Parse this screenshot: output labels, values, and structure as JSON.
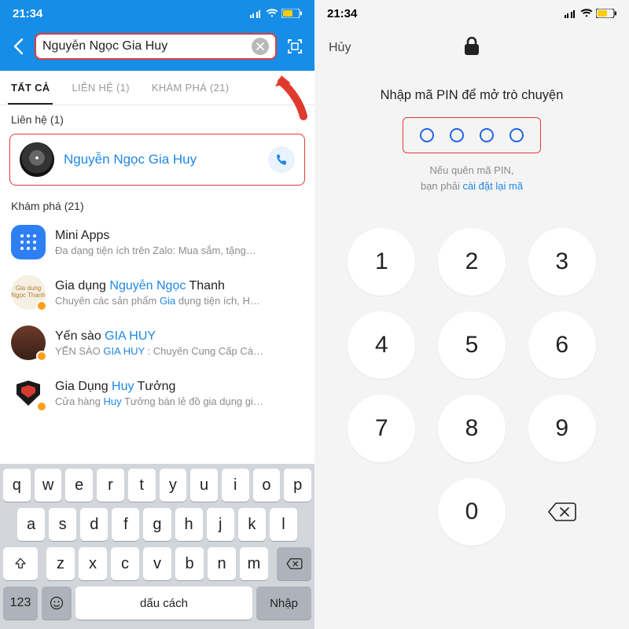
{
  "status": {
    "time": "21:34"
  },
  "left": {
    "search_value": "Nguyễn Ngọc Gia Huy",
    "tabs": {
      "all": "TẤT CẢ",
      "contacts": "LIÊN HỆ (1)",
      "discover": "KHÁM PHÁ (21)"
    },
    "section_contacts": "Liên hệ (1)",
    "contact_name": "Nguyễn Ngọc Gia Huy",
    "section_discover": "Khám phá (21)",
    "items": [
      {
        "title_pre": "",
        "title_hl": "",
        "title_post": "Mini Apps",
        "sub_pre": "Đa dạng tiện ích trên Zalo: Mua sắm, tặng…",
        "sub_hl": "",
        "sub_post": ""
      },
      {
        "title_pre": "Gia dụng ",
        "title_hl": "Nguyễn Ngọc",
        "title_post": " Thanh",
        "sub_pre": "Chuyên các sản phẩm ",
        "sub_hl": "Gia",
        "sub_post": " dụng tiện ích, H…"
      },
      {
        "title_pre": "Yến sào ",
        "title_hl": "GIA HUY",
        "title_post": "",
        "sub_pre": "YẾN SÀO ",
        "sub_hl": "GIA HUY",
        "sub_post": " : Chuyên Cung Cấp Cá…"
      },
      {
        "title_pre": "Gia Dụng ",
        "title_hl": "Huy",
        "title_post": " Tưởng",
        "sub_pre": "Cửa hàng ",
        "sub_hl": "Huy",
        "sub_post": " Tưởng bán lẻ đồ gia dụng gi…"
      }
    ],
    "keyboard": {
      "r1": [
        "q",
        "w",
        "e",
        "r",
        "t",
        "y",
        "u",
        "i",
        "o",
        "p"
      ],
      "r2": [
        "a",
        "s",
        "d",
        "f",
        "g",
        "h",
        "j",
        "k",
        "l"
      ],
      "r3": [
        "z",
        "x",
        "c",
        "v",
        "b",
        "n",
        "m"
      ],
      "num": "123",
      "space": "dấu cách",
      "enter": "Nhập"
    }
  },
  "right": {
    "cancel": "Hủy",
    "title": "Nhập mã PIN để mở trò chuyện",
    "hint_line1": "Nếu quên mã PIN,",
    "hint_line2_pre": "bạn phải ",
    "hint_link": "cài đặt lại mã",
    "keys": [
      "1",
      "2",
      "3",
      "4",
      "5",
      "6",
      "7",
      "8",
      "9",
      "0"
    ]
  }
}
